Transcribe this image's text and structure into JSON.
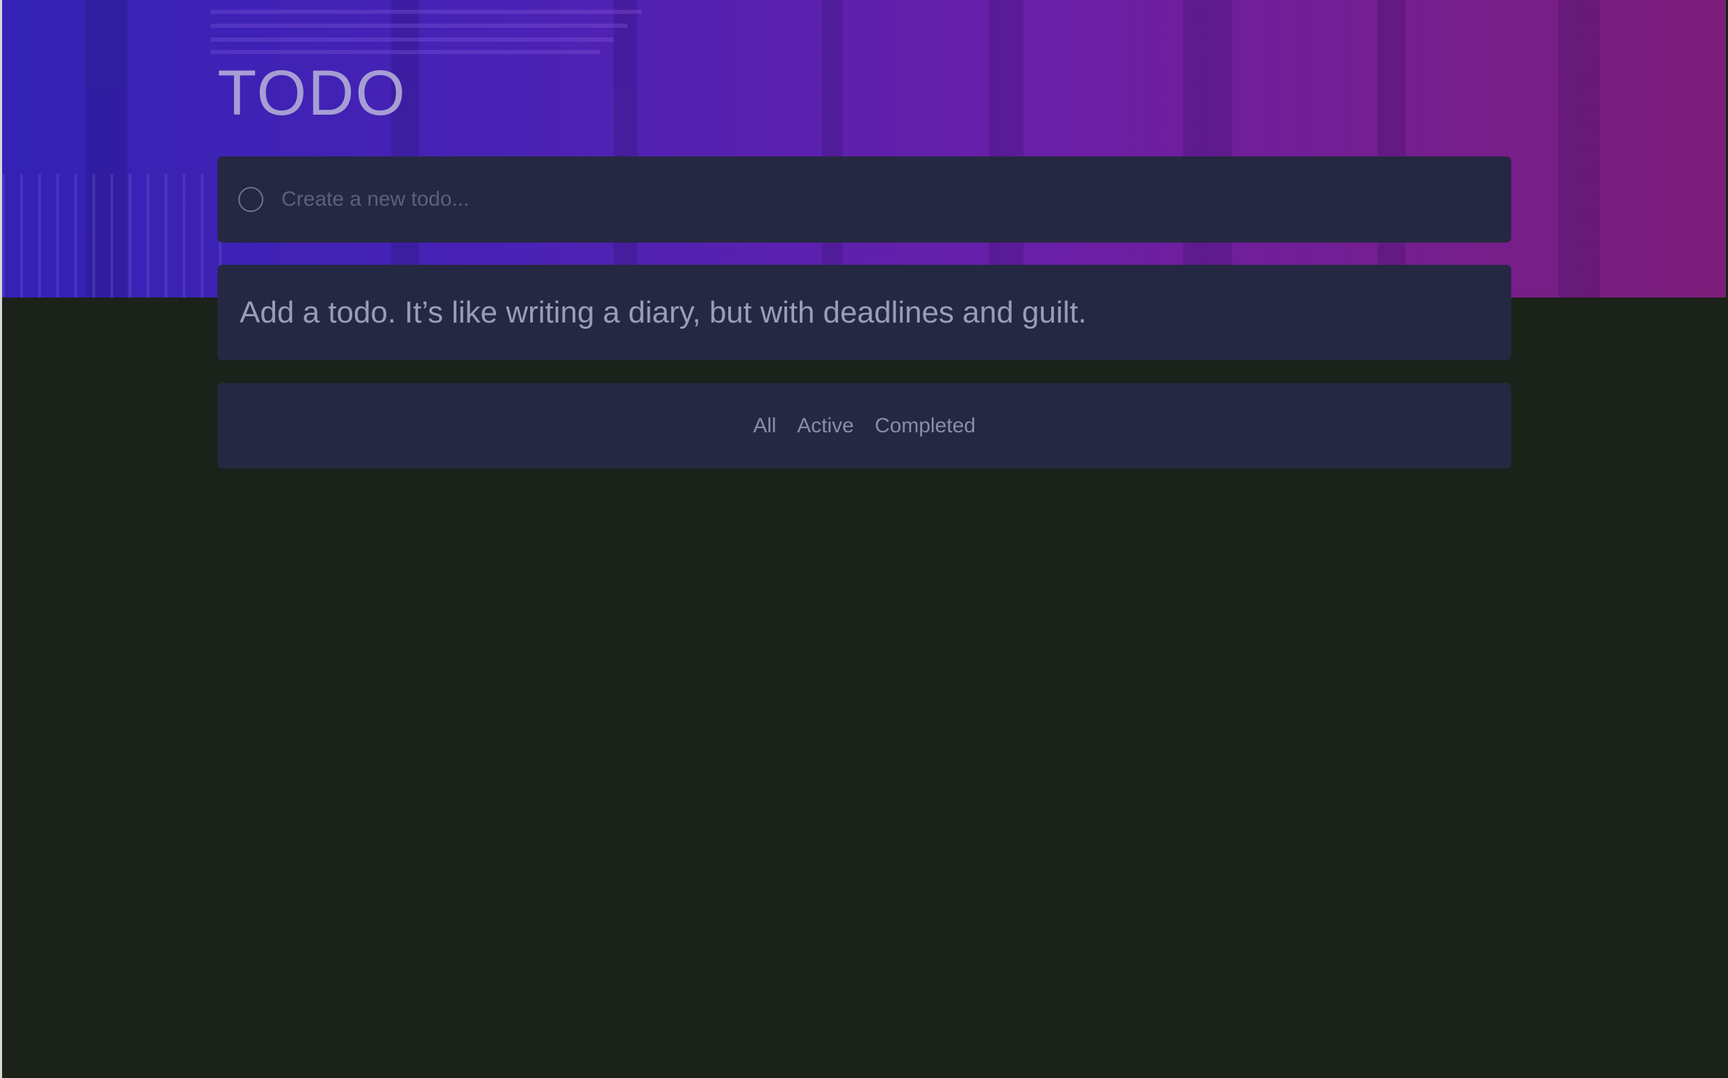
{
  "app": {
    "title": "TODO"
  },
  "new_todo": {
    "placeholder": "Create a new todo...",
    "value": ""
  },
  "empty_state": {
    "message": "Add a todo. It’s like writing a diary, but with deadlines and guilt."
  },
  "filters": {
    "all_label": "All",
    "active_label": "Active",
    "completed_label": "Completed"
  },
  "colors": {
    "page_background": "#1b221a",
    "card_background": "#252842",
    "hero_gradient_start": "#3322b5",
    "hero_gradient_end": "#7d1d7a",
    "title_color": "#a69ed3"
  },
  "icons": {
    "checkbox": "empty-circle-icon"
  }
}
